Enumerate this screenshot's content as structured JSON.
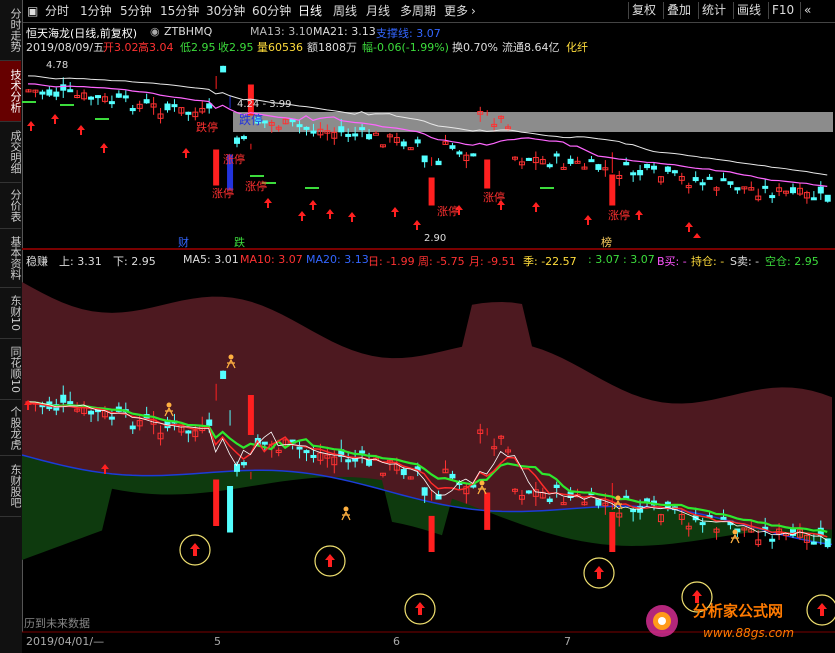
{
  "toolbar": {
    "items": [
      "分时",
      "1分钟",
      "5分钟",
      "15分钟",
      "30分钟",
      "60分钟",
      "日线",
      "周线",
      "月线",
      "多周期",
      "更多"
    ],
    "right": [
      "复权",
      "叠加",
      "统计",
      "画线",
      "F10"
    ]
  },
  "side_tabs": [
    "分时走势",
    "技术分析",
    "成交明细",
    "分价表",
    "基本资料",
    "东财10",
    "同花顺10",
    "个股龙虎",
    "东财股吧"
  ],
  "price_panel": {
    "title": "恒天海龙(日线,前复权)",
    "code": "ZTBHMQ",
    "ma13": "MA13: 3.10",
    "ma21": "MA21: 3.13",
    "zhicheng": "支撑线: 3.07",
    "date": "2019/08/09/五",
    "open": "开3.02",
    "high": "高3.04",
    "low": "低2.95",
    "close": "收2.95",
    "vol": "量60536",
    "amount": "额1808万",
    "change": "幅-0.06(-1.99%)",
    "turnover": "换0.70%",
    "float": "流通8.64亿",
    "industry": "化纤",
    "labels": {
      "hi": "4.78",
      "range": "4.24 - 3.99",
      "lo": "2.90",
      "dieting": "跌停",
      "zhangting": "涨停",
      "cai": "财",
      "die": "跌",
      "bang": "榜"
    }
  },
  "indicator_panel": {
    "name": "稳赚",
    "up": "上: 3.31",
    "down": "下: 2.95",
    "ma5": "MA5: 3.01",
    "ma10": "MA10: 3.07",
    "ma20": "MA20: 3.13",
    "ri": "日: -1.99",
    "zhou": "周: -5.75",
    "yue": "月: -9.51",
    "ji": "季: -22.57",
    "v1": ": 3.07",
    "v2": ": 3.07",
    "bmai": "B买: -",
    "chicang": "持仓: -",
    "smai": "S卖: -",
    "kongcang": "空仓: 2.95"
  },
  "footer": {
    "future_text": "历到未来数据",
    "date_box": "2019/04/01/—",
    "months": [
      "5",
      "6",
      "7"
    ]
  },
  "watermark": {
    "text": "分析家公式网",
    "url": "www.88gs.com"
  },
  "colors": {
    "up": "#ff3232",
    "down": "#54ffff",
    "bg": "#000000",
    "band_top": "#5a1b22",
    "band_bot": "#0c3d10"
  }
}
